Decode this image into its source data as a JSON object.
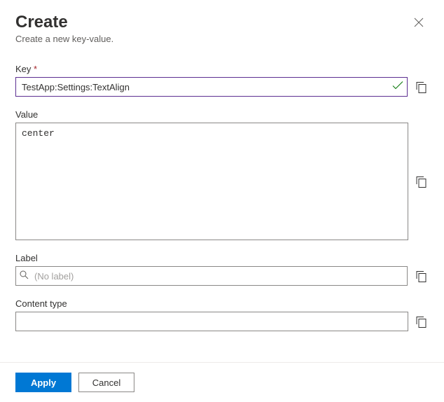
{
  "header": {
    "title": "Create",
    "subtitle": "Create a new key-value."
  },
  "fields": {
    "key": {
      "label": "Key",
      "required_marker": "*",
      "value": "TestApp:Settings:TextAlign",
      "validated": true
    },
    "value": {
      "label": "Value",
      "value": "center"
    },
    "label": {
      "label": "Label",
      "placeholder": "(No label)",
      "value": ""
    },
    "content_type": {
      "label": "Content type",
      "value": ""
    }
  },
  "buttons": {
    "apply": "Apply",
    "cancel": "Cancel"
  }
}
